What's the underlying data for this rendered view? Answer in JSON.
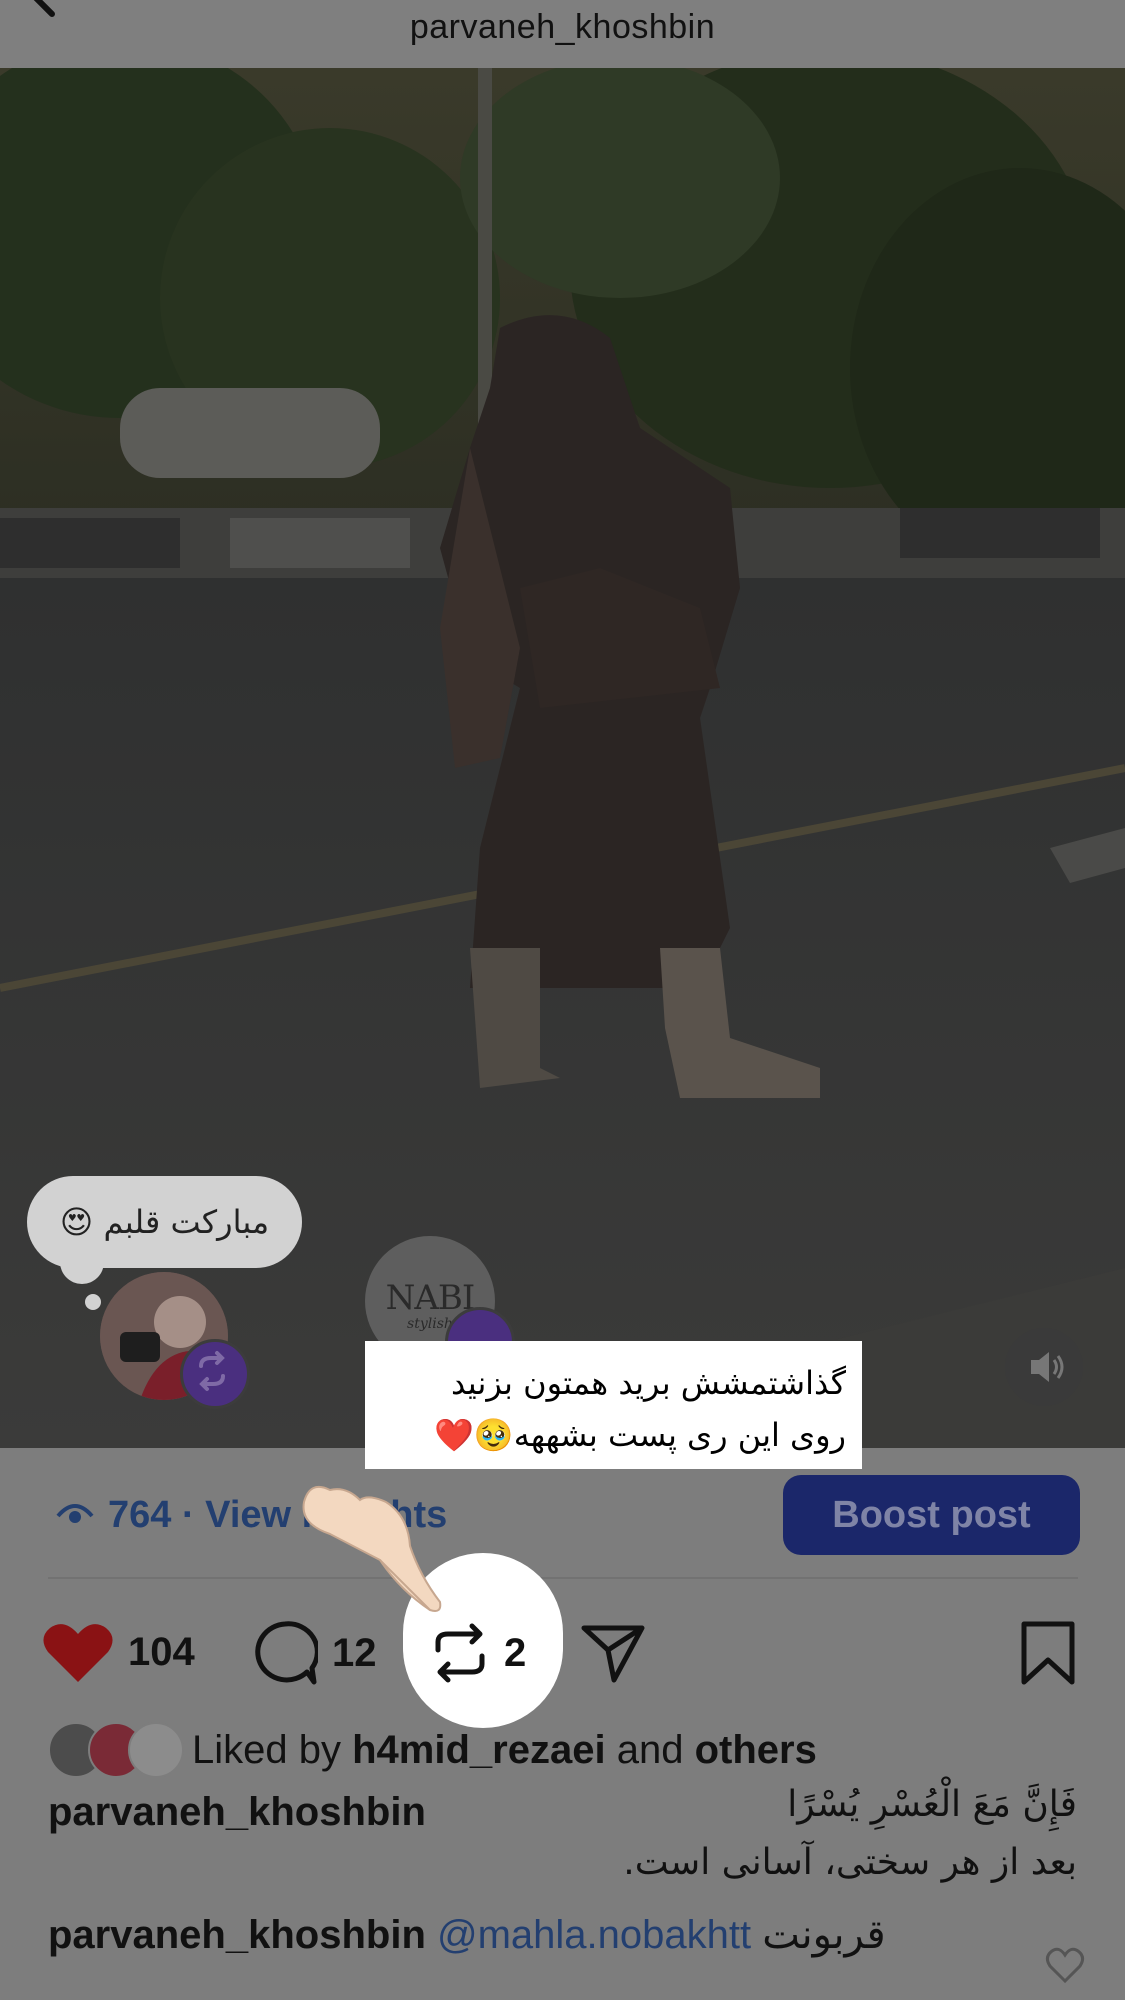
{
  "header": {
    "title": "parvaneh_khoshbin"
  },
  "photo": {
    "comment_bubble_text": "مبارکت قلبم 😍",
    "nabi_logo_text": "NABI",
    "nabi_logo_subtext": "stylish"
  },
  "overlay_caption": {
    "line1": "گذاشتمشش برید همتون بزنید",
    "line2": "روی این ری پست بشههه🥹❤️"
  },
  "insights": {
    "text": "764 · View insights"
  },
  "boost": {
    "label": "Boost post"
  },
  "actions": {
    "likes": "104",
    "comments": "12",
    "reposts": "2"
  },
  "liked_by": {
    "prefix": "Liked by",
    "user": "h4mid_rezaei",
    "and": "and",
    "others": "others"
  },
  "caption": {
    "username": "parvaneh_khoshbin",
    "arabic": "فَإِنَّ مَعَ الْعُسْرِ يُسْرًا",
    "persian": "بعد از هر سختی، آسانی است."
  },
  "comment": {
    "username": "parvaneh_khoshbin",
    "mention": "@mahla.nobakhtt",
    "text": "قربونت"
  },
  "colors": {
    "accent_blue": "#233f70",
    "boost_bg": "#1b276a",
    "heart_red": "#8a1214",
    "repost_badge": "#4a2f7f"
  }
}
